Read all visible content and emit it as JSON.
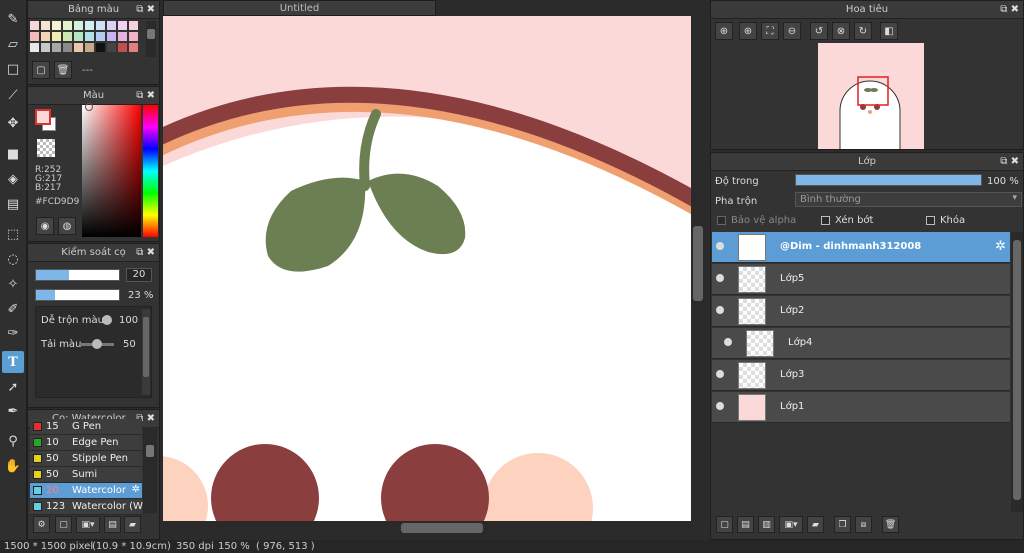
{
  "canvas": {
    "tab_title": "Untitled"
  },
  "palette": {
    "title": "Bảng màu",
    "dash": "---"
  },
  "color": {
    "title": "Màu",
    "r": "R:252",
    "g": "G:217",
    "b": "B:217",
    "hex": "#FCD9D9"
  },
  "brush_control": {
    "title": "Kiểm soát cọ",
    "size_value": "20",
    "opacity_value": "23 %",
    "blend_label": "Dễ trộn màu",
    "blend_value": "100",
    "flow_label": "Tải màu",
    "flow_value": "50",
    "size_fill": 0.4,
    "opacity_fill": 0.23
  },
  "brushes": {
    "title": "Cọ: Watercolor",
    "items": [
      {
        "size": "15",
        "name": "G Pen",
        "color": "#e53030"
      },
      {
        "size": "10",
        "name": "Edge Pen",
        "color": "#22aa22"
      },
      {
        "size": "50",
        "name": "Stipple Pen",
        "color": "#e8d020"
      },
      {
        "size": "50",
        "name": "Sumi",
        "color": "#e8d020"
      },
      {
        "size": "20",
        "name": "Watercolor",
        "color": "#5fd0e8",
        "selected": true
      },
      {
        "size": "123",
        "name": "Watercolor (We",
        "color": "#5fd0e8"
      }
    ]
  },
  "navigator": {
    "title": "Hoa tiêu"
  },
  "layers": {
    "title": "Lớp",
    "opacity_label": "Độ trong",
    "opacity_value": "100 %",
    "opacity_fill": 1.0,
    "blend_label": "Pha trộn",
    "blend_value": "Bình thường",
    "protect_alpha": "Bảo vệ alpha",
    "clipping": "Xén bớt",
    "lock": "Khóa",
    "items": [
      {
        "name": "@Dim - dinhmanh312008",
        "selected": true
      },
      {
        "name": "Lớp5"
      },
      {
        "name": "Lớp2"
      },
      {
        "name": "Lớp4"
      },
      {
        "name": "Lớp3"
      },
      {
        "name": "Lớp1"
      }
    ]
  },
  "status": {
    "size": "1500 * 1500 pixel",
    "cm": "(10.9 * 10.9cm)",
    "dpi": "350 dpi",
    "zoom": "150 %",
    "coords": "( 976, 513 )"
  },
  "colors": {
    "accent": "#5b9dd4",
    "bg_pink": "#fcd9d9",
    "brown": "#8b3e3e",
    "orange": "#f0a070",
    "leaf": "#6b7f52"
  }
}
